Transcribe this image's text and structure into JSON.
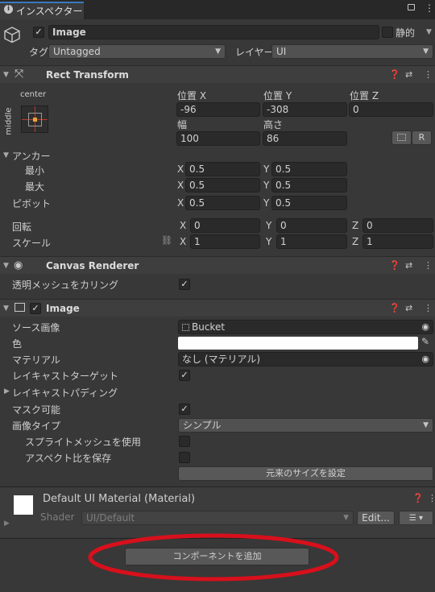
{
  "tab": {
    "title": "インスペクター"
  },
  "object": {
    "name": "Image",
    "static_label": "静的",
    "tag_label": "タグ",
    "tag_value": "Untagged",
    "layer_label": "レイヤー",
    "layer_value": "UI"
  },
  "rect": {
    "title": "Rect Transform",
    "anchor_h": "center",
    "anchor_v": "middle",
    "pos_x_label": "位置 X",
    "pos_y_label": "位置 Y",
    "pos_z_label": "位置 Z",
    "pos_x": "-96",
    "pos_y": "-308",
    "pos_z": "0",
    "width_label": "幅",
    "height_label": "高さ",
    "width": "100",
    "height": "86",
    "r_btn": "R",
    "anchors_label": "アンカー",
    "min_label": "最小",
    "max_label": "最大",
    "pivot_label": "ピボット",
    "min_x": "0.5",
    "min_y": "0.5",
    "max_x": "0.5",
    "max_y": "0.5",
    "pivot_x": "0.5",
    "pivot_y": "0.5",
    "rotation_label": "回転",
    "scale_label": "スケール",
    "rot_x": "0",
    "rot_y": "0",
    "rot_z": "0",
    "scale_x": "1",
    "scale_y": "1",
    "scale_z": "1",
    "x": "X",
    "y": "Y",
    "z": "Z"
  },
  "canvas_renderer": {
    "title": "Canvas Renderer",
    "cull_label": "透明メッシュをカリング"
  },
  "image": {
    "title": "Image",
    "source_label": "ソース画像",
    "source_value": "Bucket",
    "color_label": "色",
    "material_label": "マテリアル",
    "material_value": "なし (マテリアル)",
    "raycast_target_label": "レイキャストターゲット",
    "raycast_padding_label": "レイキャストパディング",
    "maskable_label": "マスク可能",
    "image_type_label": "画像タイプ",
    "image_type_value": "シンプル",
    "sprite_mesh_label": "スプライトメッシュを使用",
    "preserve_aspect_label": "アスペクト比を保存",
    "native_size_btn": "元来のサイズを設定"
  },
  "material": {
    "title": "Default UI Material (Material)",
    "shader_label": "Shader",
    "shader_value": "UI/Default",
    "edit_btn": "Edit..."
  },
  "add_component": {
    "label": "コンポーネントを追加"
  },
  "colors": {
    "background": "#383838",
    "field": "#2a2a2a",
    "header": "#3e3e3e",
    "highlight": "#d8101c"
  }
}
